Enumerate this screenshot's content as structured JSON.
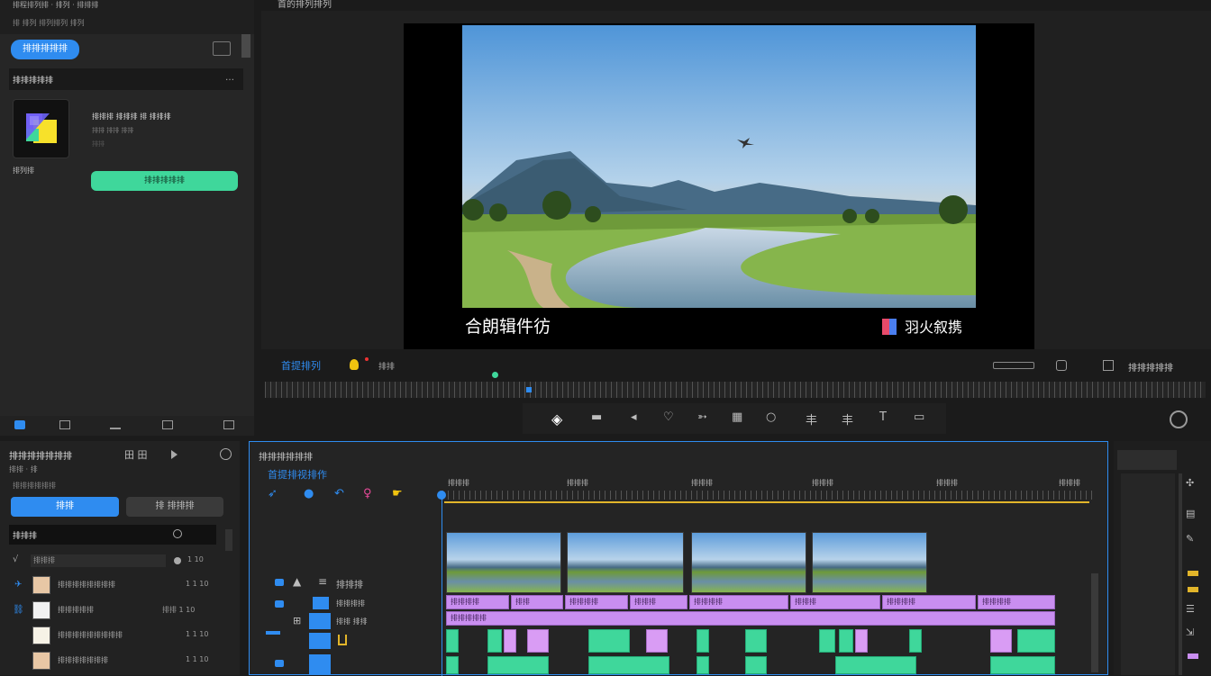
{
  "top_left_bar": {
    "line1": "排程排列排 · 排列 · 排排排",
    "line2": "排 排列 排列排列 排列"
  },
  "top_bar_title": "首的排列排列",
  "left_panel": {
    "import_button": "排排排排排",
    "section_title": "排排排排排",
    "section_more": "…",
    "item_title": "排排排 排排排 排 排排排",
    "item_sub1": "排排 排排 排排",
    "item_sub2": "排排",
    "item_caption": "排列排",
    "apply_button": "排排排排排"
  },
  "preview": {
    "caption_left": "合朗辑件彷",
    "caption_right": "羽火叙携",
    "accent_color": "#3fd79b"
  },
  "preview_controls": {
    "title": "首提排列",
    "subtitle": "排排",
    "right_label": "排排排排排"
  },
  "lower_left": {
    "title": "排排排排排排排",
    "sub": "排排 · 排",
    "tab2": "田 田",
    "info": "排排排排排排",
    "btn_primary": "排排",
    "btn_secondary": "排 排排排",
    "list_header": "排排排",
    "filter_label": "排排排",
    "rows": [
      {
        "name": "排排排排排排排排",
        "meta": "1 1 10"
      },
      {
        "name": "排排排排排",
        "meta": "排排 1 10"
      },
      {
        "name": "排排排排排排排排排",
        "meta": "1 1 10"
      },
      {
        "name": "排排排排排排排",
        "meta": "1 1 10"
      }
    ]
  },
  "timeline": {
    "header": "排排排排排排",
    "tool_title": "首提排视排作",
    "time_labels": [
      "排排排",
      "排排排",
      "排排排",
      "排排排",
      "排排排",
      "排排排"
    ],
    "track_name": "排排排",
    "track_label": "排排排排",
    "track_sub": "排排 排排",
    "purple_segments": [
      "排排排排",
      "排排",
      "排排排排",
      "排排排",
      "排排排排",
      "排排排",
      "排排排排",
      "排排排排"
    ],
    "purple_long": "排排排排排",
    "accent_yellow": "#e2b52a",
    "accent_blue": "#2f8cf0"
  }
}
